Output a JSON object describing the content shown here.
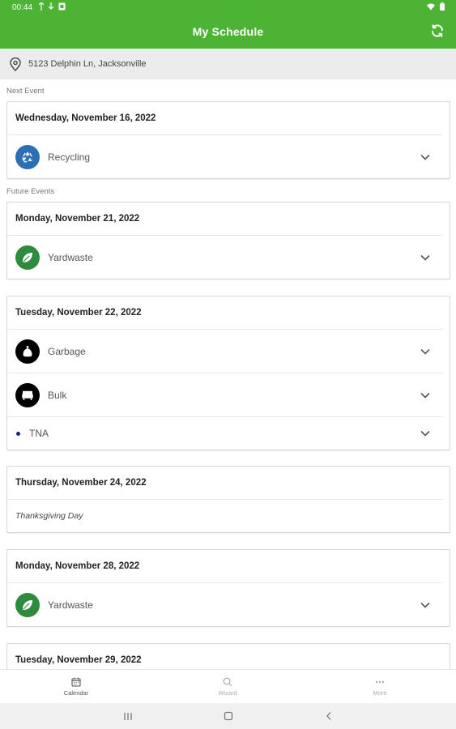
{
  "status_bar": {
    "time": "00:44"
  },
  "header": {
    "title": "My Schedule",
    "refresh_icon": "refresh-icon",
    "accent_color": "#4db335"
  },
  "address": {
    "text": "5123 Delphin Ln, Jacksonville",
    "icon": "location-pin-icon"
  },
  "sections": {
    "next_label": "Next Event",
    "future_label": "Future Events"
  },
  "cards": [
    {
      "date": "Wednesday, November 16, 2022",
      "events": [
        {
          "label": "Recycling",
          "icon": "recycling-icon",
          "color": "#2d6fb5"
        }
      ]
    },
    {
      "date": "Monday, November 21, 2022",
      "events": [
        {
          "label": "Yardwaste",
          "icon": "leaf-icon",
          "color": "#2e8b3e"
        }
      ]
    },
    {
      "date": "Tuesday, November 22, 2022",
      "events": [
        {
          "label": "Garbage",
          "icon": "trash-bag-icon",
          "color": "#000000"
        },
        {
          "label": "Bulk",
          "icon": "bulk-item-icon",
          "color": "#000000"
        },
        {
          "label": "TNA",
          "icon": "dot-icon",
          "color": "#1a237e"
        }
      ]
    },
    {
      "date": "Thursday, November 24, 2022",
      "holiday": "Thanksgiving Day"
    },
    {
      "date": "Monday, November 28, 2022",
      "events": [
        {
          "label": "Yardwaste",
          "icon": "leaf-icon",
          "color": "#2e8b3e"
        }
      ]
    },
    {
      "date": "Tuesday, November 29, 2022"
    }
  ],
  "bottom_nav": {
    "items": [
      {
        "label": "Calendar",
        "icon": "calendar-icon",
        "active": true
      },
      {
        "label": "Wizard",
        "icon": "search-icon",
        "active": false
      },
      {
        "label": "More",
        "icon": "more-icon",
        "active": false
      }
    ]
  }
}
